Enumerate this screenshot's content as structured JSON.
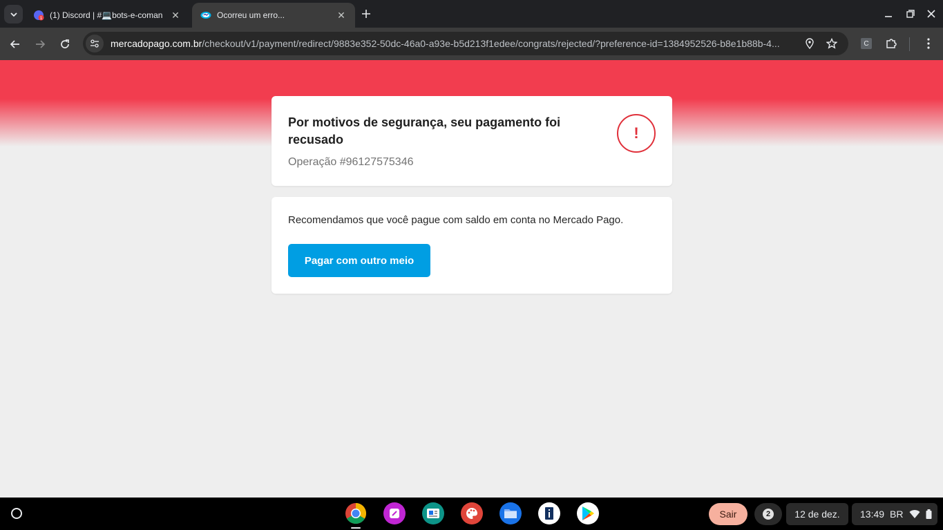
{
  "browser": {
    "tabs": [
      {
        "title": "(1) Discord | #💻bots-e-coman",
        "active": false,
        "favicon": "discord-icon"
      },
      {
        "title": "Ocorreu um erro...",
        "active": true,
        "favicon": "mercadopago-icon"
      }
    ],
    "url": {
      "host": "mercadopago.com.br",
      "path": "/checkout/v1/payment/redirect/9883e352-50dc-46a0-a93e-b5d213f1edee/congrats/rejected/?preference-id=1384952526-b8e1b88b-4..."
    },
    "extension_badge": "C"
  },
  "page": {
    "status_card": {
      "title": "Por motivos de segurança, seu pagamento foi recusado",
      "operation": "Operação #96127575346",
      "icon_glyph": "!"
    },
    "recommendation_card": {
      "text": "Recomendamos que você pague com saldo em conta no Mercado Pago.",
      "button_label": "Pagar com outro meio"
    },
    "colors": {
      "accent_red": "#f23d4f",
      "button_blue": "#009ee3"
    }
  },
  "shelf": {
    "apps": [
      "chrome-icon",
      "canvas-icon",
      "classroom-icon",
      "palette-icon",
      "files-icon",
      "app-i-icon",
      "play-store-icon"
    ],
    "sair_label": "Sair",
    "notification_count": "2",
    "date": "12 de dez.",
    "time": "13:49",
    "input_method": "BR"
  }
}
